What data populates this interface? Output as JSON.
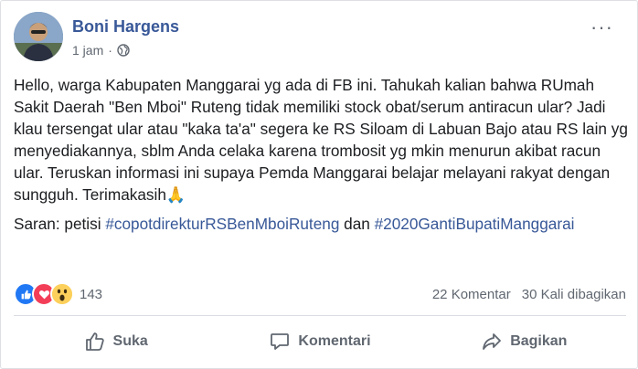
{
  "post": {
    "author": "Boni Hargens",
    "time": "1 jam",
    "separator": "·",
    "privacy_icon": "globe-icon",
    "more_icon": "···",
    "paragraphs": [
      "Hello, warga Kabupaten Manggarai yg ada di FB ini. Tahukah kalian bahwa RUmah Sakit Daerah \"Ben Mboi\" Ruteng tidak memiliki stock obat/serum antiracun ular? Jadi klau tersengat ular atau \"kaka ta'a\" segera ke RS Siloam di Labuan Bajo atau RS lain yg menyediakannya, sblm Anda celaka karena trombosit yg mkin menurun akibat racun ular. Teruskan informasi ini supaya Pemda Manggarai belajar melayani rakyat dengan sungguh. Terimakasih🙏"
    ],
    "suggestion_prefix": "Saran: petisi ",
    "hashtag1": "#copotdirekturRSBenMboiRuteng",
    "connector": " dan ",
    "hashtag2": "#2020GantiBupatiManggarai"
  },
  "reactions": {
    "count": "143",
    "icons": [
      "like-icon",
      "love-icon",
      "wow-icon"
    ],
    "colors": {
      "like": "#2078f4",
      "love": "#f33e58",
      "wow": "#fcd05b"
    }
  },
  "stats": {
    "comments": "22 Komentar",
    "shares": "30 Kali dibagikan"
  },
  "actions": {
    "like": "Suka",
    "comment": "Komentari",
    "share": "Bagikan"
  },
  "colors": {
    "link": "#385898",
    "secondary_text": "#606770"
  }
}
